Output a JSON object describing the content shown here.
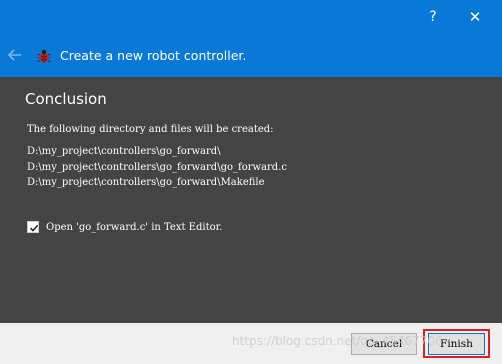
{
  "titlebar": {
    "help_label": "?",
    "close_label": "✕"
  },
  "header": {
    "back_icon": "back-arrow-icon",
    "app_icon": "bug-icon",
    "title": "Create a new robot controller."
  },
  "main": {
    "section_title": "Conclusion",
    "intro": "The following directory and files will be created:",
    "paths": [
      "D:\\my_project\\controllers\\go_forward\\",
      "D:\\my_project\\controllers\\go_forward\\go_forward.c",
      "D:\\my_project\\controllers\\go_forward\\Makefile"
    ],
    "open_checkbox_checked": true,
    "open_label": "Open 'go_forward.c' in Text Editor."
  },
  "footer": {
    "cancel_label": "Cancel",
    "finish_label": "Finish",
    "watermark": "https://blog.csdn.net/qq_45467706"
  },
  "colors": {
    "accent": "#0a78d7",
    "body_bg": "#444444",
    "footer_bg": "#f0f0f0",
    "highlight": "#e02020"
  }
}
